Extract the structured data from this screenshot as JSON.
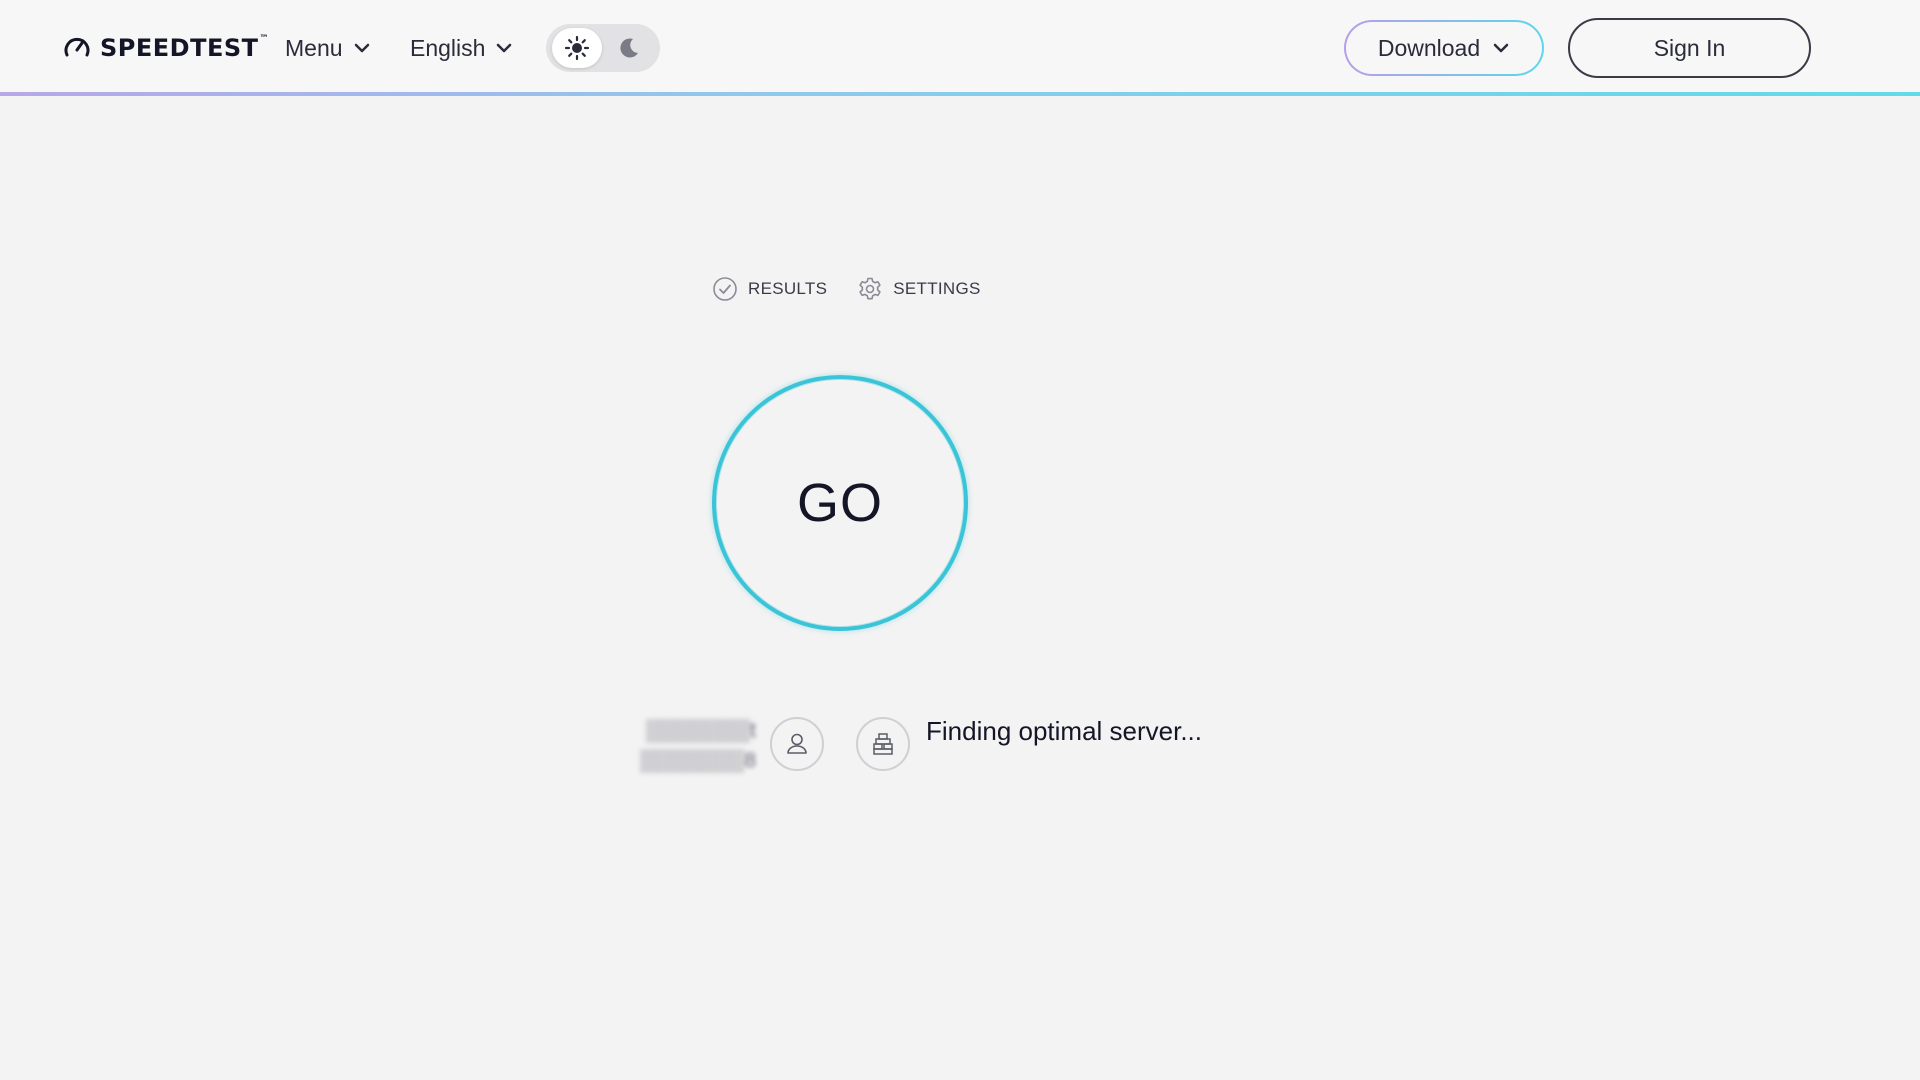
{
  "header": {
    "logo_text": "SPEEDTEST",
    "logo_tm": "™",
    "menu_label": "Menu",
    "language_label": "English",
    "download_label": "Download",
    "signin_label": "Sign In"
  },
  "tabs": {
    "results_label": "RESULTS",
    "settings_label": "SETTINGS"
  },
  "main": {
    "go_label": "GO",
    "isp_line1": "▒▒▒▒▒▒▒t",
    "isp_line2": "▒▒▒▒▒▒▒8",
    "server_status": "Finding optimal server..."
  },
  "colors": {
    "accent": "#3ac4d8",
    "gradient_start": "#b79ee8",
    "gradient_end": "#5cd7ec",
    "background": "#f3f3f3"
  },
  "icons": [
    "speedometer-icon",
    "chevron-down-icon",
    "sun-icon",
    "moon-icon",
    "check-circle-icon",
    "gear-icon",
    "user-icon",
    "server-icon"
  ]
}
